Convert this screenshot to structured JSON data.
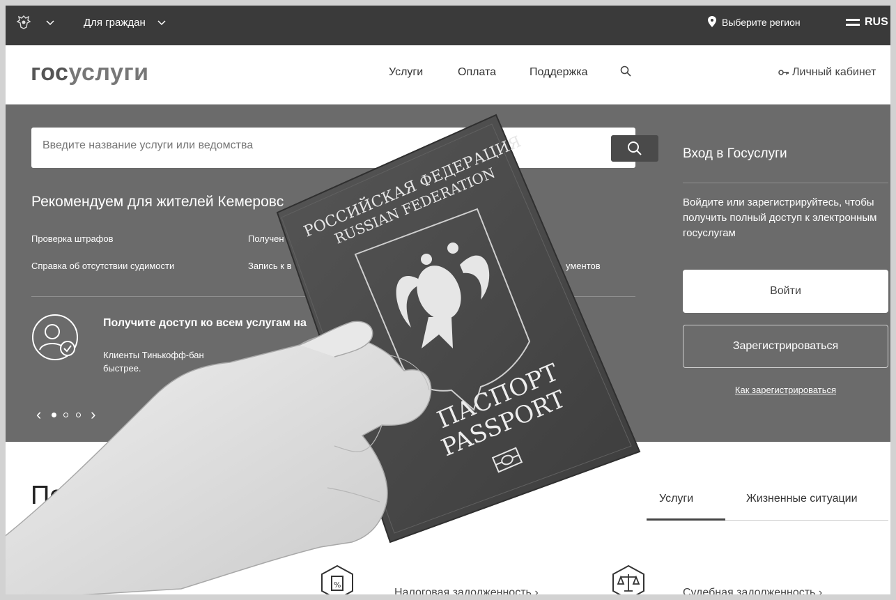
{
  "topbar": {
    "emblem_icon": "coat-of-arms-icon",
    "citizens_label": "Для граждан",
    "region_label": "Выберите регион",
    "lang_label": "RUS"
  },
  "header": {
    "logo_part1": "гос",
    "logo_part2": "услуги",
    "nav": [
      "Услуги",
      "Оплата",
      "Поддержка"
    ],
    "cabinet_label": "Личный кабинет"
  },
  "hero": {
    "search_placeholder": "Введите название услуги или ведомства",
    "recommend_title": "Рекомендуем для жителей Кемеровс",
    "quick_links": [
      "Проверка штрафов",
      "Получен",
      "Справка об отсутствии судимости",
      "Запись к в",
      "ументов"
    ],
    "promo_title": "Получите доступ ко всем услугам на",
    "promo_text_line1": "Клиенты Тинькофф-бан",
    "promo_text_line2": "быстрее.",
    "slider_prev": "‹",
    "slider_next": "›"
  },
  "login": {
    "title": "Вход в Госуслуги",
    "description": "Войдите или зарегистрируйтесь, чтобы получить полный доступ к электронным госуслугам",
    "login_button": "Войти",
    "register_button": "Зарегистрироваться",
    "how_to_register": "Как зарегистрироваться"
  },
  "popular": {
    "title": "Попу",
    "tabs": [
      "Услуги",
      "Жизненные ситуации"
    ],
    "services": [
      "Налоговая задолженность ›",
      "Судебная задолженность ›"
    ]
  },
  "passport": {
    "line1": "РОССИЙСКАЯ ФЕДЕРАЦИЯ",
    "line2": "RUSSIAN FEDERATION",
    "line3": "ПАСПОРТ",
    "line4": "PASSPORT"
  },
  "colors": {
    "topbar": "#3a3a3a",
    "hero": "#6b6b6b",
    "passport": "#4a4a4a"
  }
}
